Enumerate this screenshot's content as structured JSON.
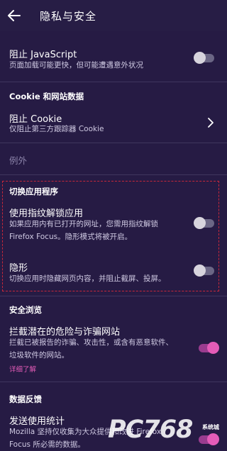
{
  "appbar": {
    "title": "隐私与安全",
    "back_icon": "arrow-left-icon"
  },
  "javascript": {
    "title": "阻止 JavaScript",
    "subtitle": "页面加载可能更快，但可能遭遇意外状况",
    "toggle": "off"
  },
  "cookie_section": {
    "header": "Cookie 和网站数据"
  },
  "cookie": {
    "title": "阻止 Cookie",
    "subtitle": "仅阻止第三方跟踪器 Cookie",
    "chevron_icon": "chevron-right-icon"
  },
  "exceptions": {
    "label": "例外"
  },
  "app_switch_section": {
    "header": "切换应用程序"
  },
  "fingerprint": {
    "title": "使用指纹解锁应用",
    "subtitle_line1": "如果应用内有已打开的网址，您需用指纹解锁",
    "subtitle_line2": "Firefox Focus。隐形模式将被开启。",
    "toggle": "off"
  },
  "stealth": {
    "title": "隐形",
    "subtitle": "切换应用时隐藏网页内容，并阻止截屏、投屏。",
    "toggle": "off"
  },
  "safe_browsing_section": {
    "header": "安全浏览"
  },
  "block_dangerous": {
    "title": "拦截潜在的危险与诈骗网站",
    "subtitle_line1": "拦截已被报告的诈骗、攻击性，或含有恶意软件、",
    "subtitle_line2": "垃圾软件的网站。",
    "learn_more": "详细了解",
    "toggle": "on"
  },
  "data_feedback_section": {
    "header": "数据反馈"
  },
  "telemetry": {
    "title": "发送使用统计",
    "subtitle_line1": "Mozilla 坚持仅收集为大众提供和改进 Firefox",
    "subtitle_line2": "Focus 所必需的数据。",
    "toggle": "on"
  },
  "watermark": {
    "text": "PC768",
    "small": "系统城"
  },
  "colors": {
    "background": "#261b44",
    "accent": "#e45cb8",
    "divider": "#3f365e"
  }
}
